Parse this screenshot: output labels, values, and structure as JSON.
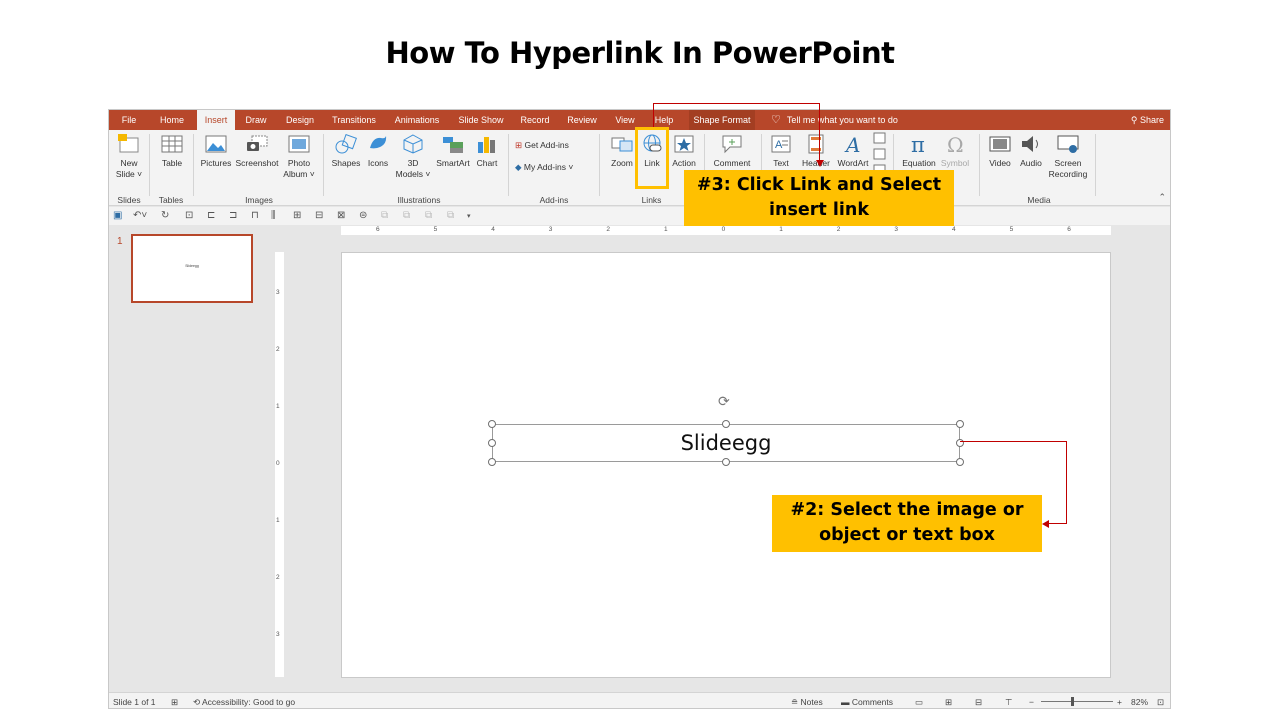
{
  "page": {
    "title": "How To Hyperlink In PowerPoint"
  },
  "tabs": [
    "File",
    "Home",
    "Insert",
    "Draw",
    "Design",
    "Transitions",
    "Animations",
    "Slide Show",
    "Record",
    "Review",
    "View",
    "Help",
    "Shape Format"
  ],
  "active_tab": "Insert",
  "tell_me": "Tell me what you want to do",
  "share": "Share",
  "ribbon": {
    "new_slide": [
      "New",
      "Slide ˅"
    ],
    "table": "Table",
    "pictures": "Pictures",
    "screenshot": "Screenshot",
    "photo_album": [
      "Photo",
      "Album ˅"
    ],
    "shapes": "Shapes",
    "icons": "Icons",
    "models_3d": [
      "3D",
      "Models ˅"
    ],
    "smartart": "SmartArt",
    "chart": "Chart",
    "get_addins": "Get Add-ins",
    "my_addins": "My Add-ins",
    "zoom": "Zoom",
    "link": "Link",
    "action": "Action",
    "comment": "Comment",
    "text": "Text",
    "header": "Header",
    "wordart": "WordArt",
    "equation": "Equation",
    "symbol": "Symbol",
    "video": "Video",
    "audio": "Audio",
    "screen_recording": [
      "Screen",
      "Recording"
    ],
    "groups": {
      "slides": "Slides",
      "tables": "Tables",
      "images": "Images",
      "illustrations": "Illustrations",
      "addins": "Add-ins",
      "links": "Links",
      "media": "Media"
    }
  },
  "thumbnail": {
    "number": "1",
    "text": "Slideegg"
  },
  "slide": {
    "textbox": "Slideegg"
  },
  "status": {
    "slide_of": "Slide 1 of 1",
    "accessibility": "Accessibility: Good to go",
    "notes": "Notes",
    "comments": "Comments",
    "zoom": "82%"
  },
  "ruler": {
    "h": [
      "6",
      "5",
      "4",
      "3",
      "2",
      "1",
      "0",
      "1",
      "2",
      "3",
      "4",
      "5",
      "6"
    ],
    "v": [
      "3",
      "2",
      "1",
      "0",
      "1",
      "2",
      "3"
    ]
  },
  "annotations": {
    "step3": [
      "#3: Click Link and Select",
      "insert link"
    ],
    "step2": [
      "#2: Select the image or",
      "object or text box"
    ]
  },
  "colors": {
    "accent": "#b7472a",
    "callout": "#ffc000",
    "arrow": "#c00000"
  }
}
